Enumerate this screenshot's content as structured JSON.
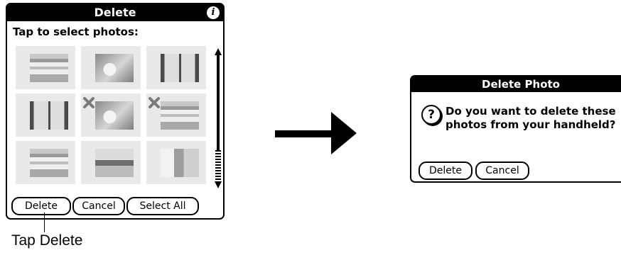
{
  "delete_dialog": {
    "title": "Delete",
    "prompt": "Tap to select photos:",
    "thumbnails": [
      {
        "photo": "keyboard",
        "selected": false
      },
      {
        "photo": "cat",
        "selected": false
      },
      {
        "photo": "window",
        "selected": false
      },
      {
        "photo": "window",
        "selected": false
      },
      {
        "photo": "cat",
        "selected": true
      },
      {
        "photo": "keyboard",
        "selected": true
      },
      {
        "photo": "keyboard",
        "selected": false
      },
      {
        "photo": "desk",
        "selected": false
      },
      {
        "photo": "room",
        "selected": false
      }
    ],
    "buttons": {
      "delete": "Delete",
      "cancel": "Cancel",
      "select_all": "Select All"
    }
  },
  "callout": {
    "text": "Tap Delete"
  },
  "confirm_dialog": {
    "title": "Delete Photo",
    "message": "Do you want to delete these photos from your handheld?",
    "buttons": {
      "delete": "Delete",
      "cancel": "Cancel"
    }
  },
  "icons": {
    "info": "info-icon",
    "question": "question-icon",
    "arrow": "right-arrow-icon",
    "selected_mark": "x-mark-icon"
  }
}
